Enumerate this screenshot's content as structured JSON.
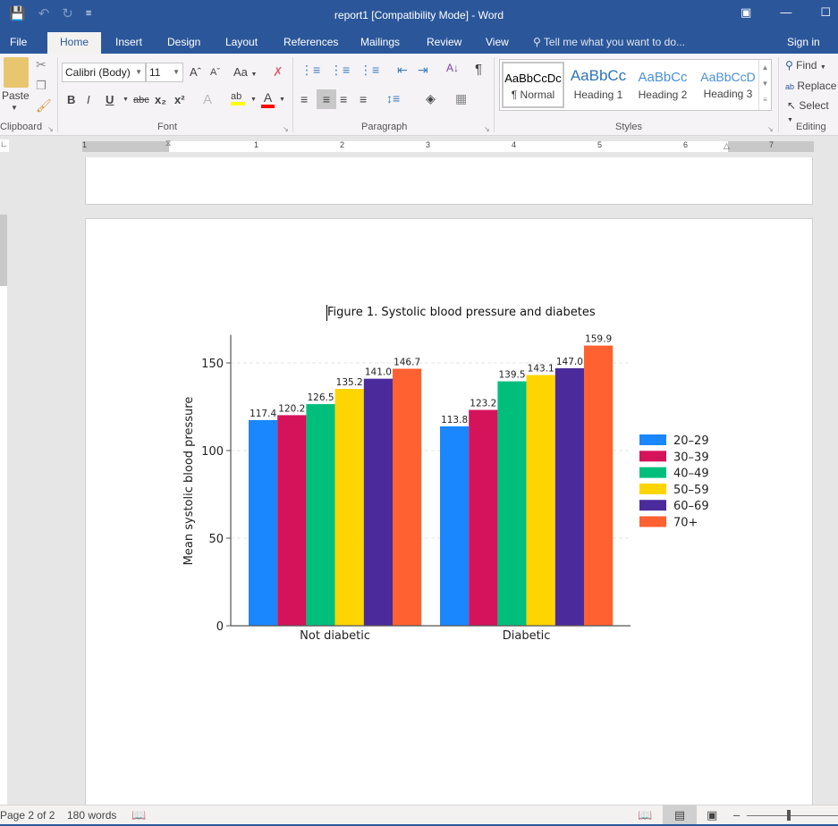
{
  "app": {
    "window_title": "report1 [Compatibility Mode] - Word",
    "qat": {
      "save_icon": "save-icon",
      "undo_icon": "undo-icon",
      "redo_icon": "redo-icon",
      "customize_icon": "customize-qat-icon"
    },
    "window_controls": [
      "ribbon-display-options-icon",
      "minimize-icon",
      "maximize-icon"
    ]
  },
  "tabs": [
    {
      "label": "File"
    },
    {
      "label": "Home",
      "active": true
    },
    {
      "label": "Insert"
    },
    {
      "label": "Design"
    },
    {
      "label": "Layout"
    },
    {
      "label": "References"
    },
    {
      "label": "Mailings"
    },
    {
      "label": "Review"
    },
    {
      "label": "View"
    }
  ],
  "tell_me": "Tell me what you want to do...",
  "sign_in": "Sign in",
  "ribbon": {
    "clipboard": {
      "label": "Clipboard",
      "paste": "Paste"
    },
    "font": {
      "label": "Font",
      "font_name": "Calibri (Body)",
      "font_size": "11",
      "change_case": "Aa",
      "bold": "B",
      "italic": "I",
      "underline": "U",
      "strike": "abc",
      "subscript": "x₂",
      "superscript": "x²",
      "highlight_color": "#ffff00",
      "font_color": "#ff0000"
    },
    "paragraph": {
      "label": "Paragraph",
      "pilcrow": "¶"
    },
    "styles": {
      "label": "Styles",
      "items": [
        {
          "preview": "AaBbCcDc",
          "name": "¶ Normal",
          "color": "#000000",
          "selected": true
        },
        {
          "preview": "AaBbCc",
          "name": "Heading 1",
          "color": "#2e74b5"
        },
        {
          "preview": "AaBbCc",
          "name": "Heading 2",
          "color": "#2e74b5"
        },
        {
          "preview": "AaBbCcD",
          "name": "Heading 3",
          "color": "#1f4e79"
        }
      ]
    },
    "editing": {
      "label": "Editing",
      "find": "Find",
      "replace": "Replace",
      "select": "Select"
    }
  },
  "ruler": {
    "numbers": [
      "1",
      "1",
      "2",
      "3",
      "4",
      "5",
      "6",
      "7"
    ]
  },
  "document": {
    "caption": "Figure 1. Systolic blood pressure and diabetes"
  },
  "chart_data": {
    "type": "bar",
    "title": "",
    "xlabel": "",
    "ylabel": "Mean systolic blood pressure",
    "categories": [
      "Not diabetic",
      "Diabetic"
    ],
    "ylim": [
      0,
      166
    ],
    "yticks": [
      0,
      50,
      100,
      150
    ],
    "grid": true,
    "legend_position": "right",
    "series": [
      {
        "name": "20–29",
        "color": "#1a87ff",
        "values": [
          117.4,
          113.8
        ],
        "labels": [
          "117.4",
          "113.8"
        ]
      },
      {
        "name": "30–39",
        "color": "#d5135b",
        "values": [
          120.2,
          123.2
        ],
        "labels": [
          "120.2",
          "123.2"
        ]
      },
      {
        "name": "40–49",
        "color": "#00bf7c",
        "values": [
          126.5,
          139.5
        ],
        "labels": [
          "126.5",
          "139.5"
        ]
      },
      {
        "name": "50–59",
        "color": "#ffd500",
        "values": [
          135.2,
          143.1
        ],
        "labels": [
          "135.2",
          "143.1"
        ]
      },
      {
        "name": "60–69",
        "color": "#4b2b9b",
        "values": [
          141.0,
          147.0
        ],
        "labels": [
          "141.0",
          "147.0"
        ]
      },
      {
        "name": "70+",
        "color": "#ff6131",
        "values": [
          146.7,
          159.9
        ],
        "labels": [
          "146.7",
          "159.9"
        ]
      }
    ]
  },
  "status": {
    "page": "Page 2 of 2",
    "words": "180 words",
    "proofing_icon": "proofing-icon",
    "views": [
      "read-mode-icon",
      "print-layout-icon",
      "web-layout-icon"
    ]
  }
}
